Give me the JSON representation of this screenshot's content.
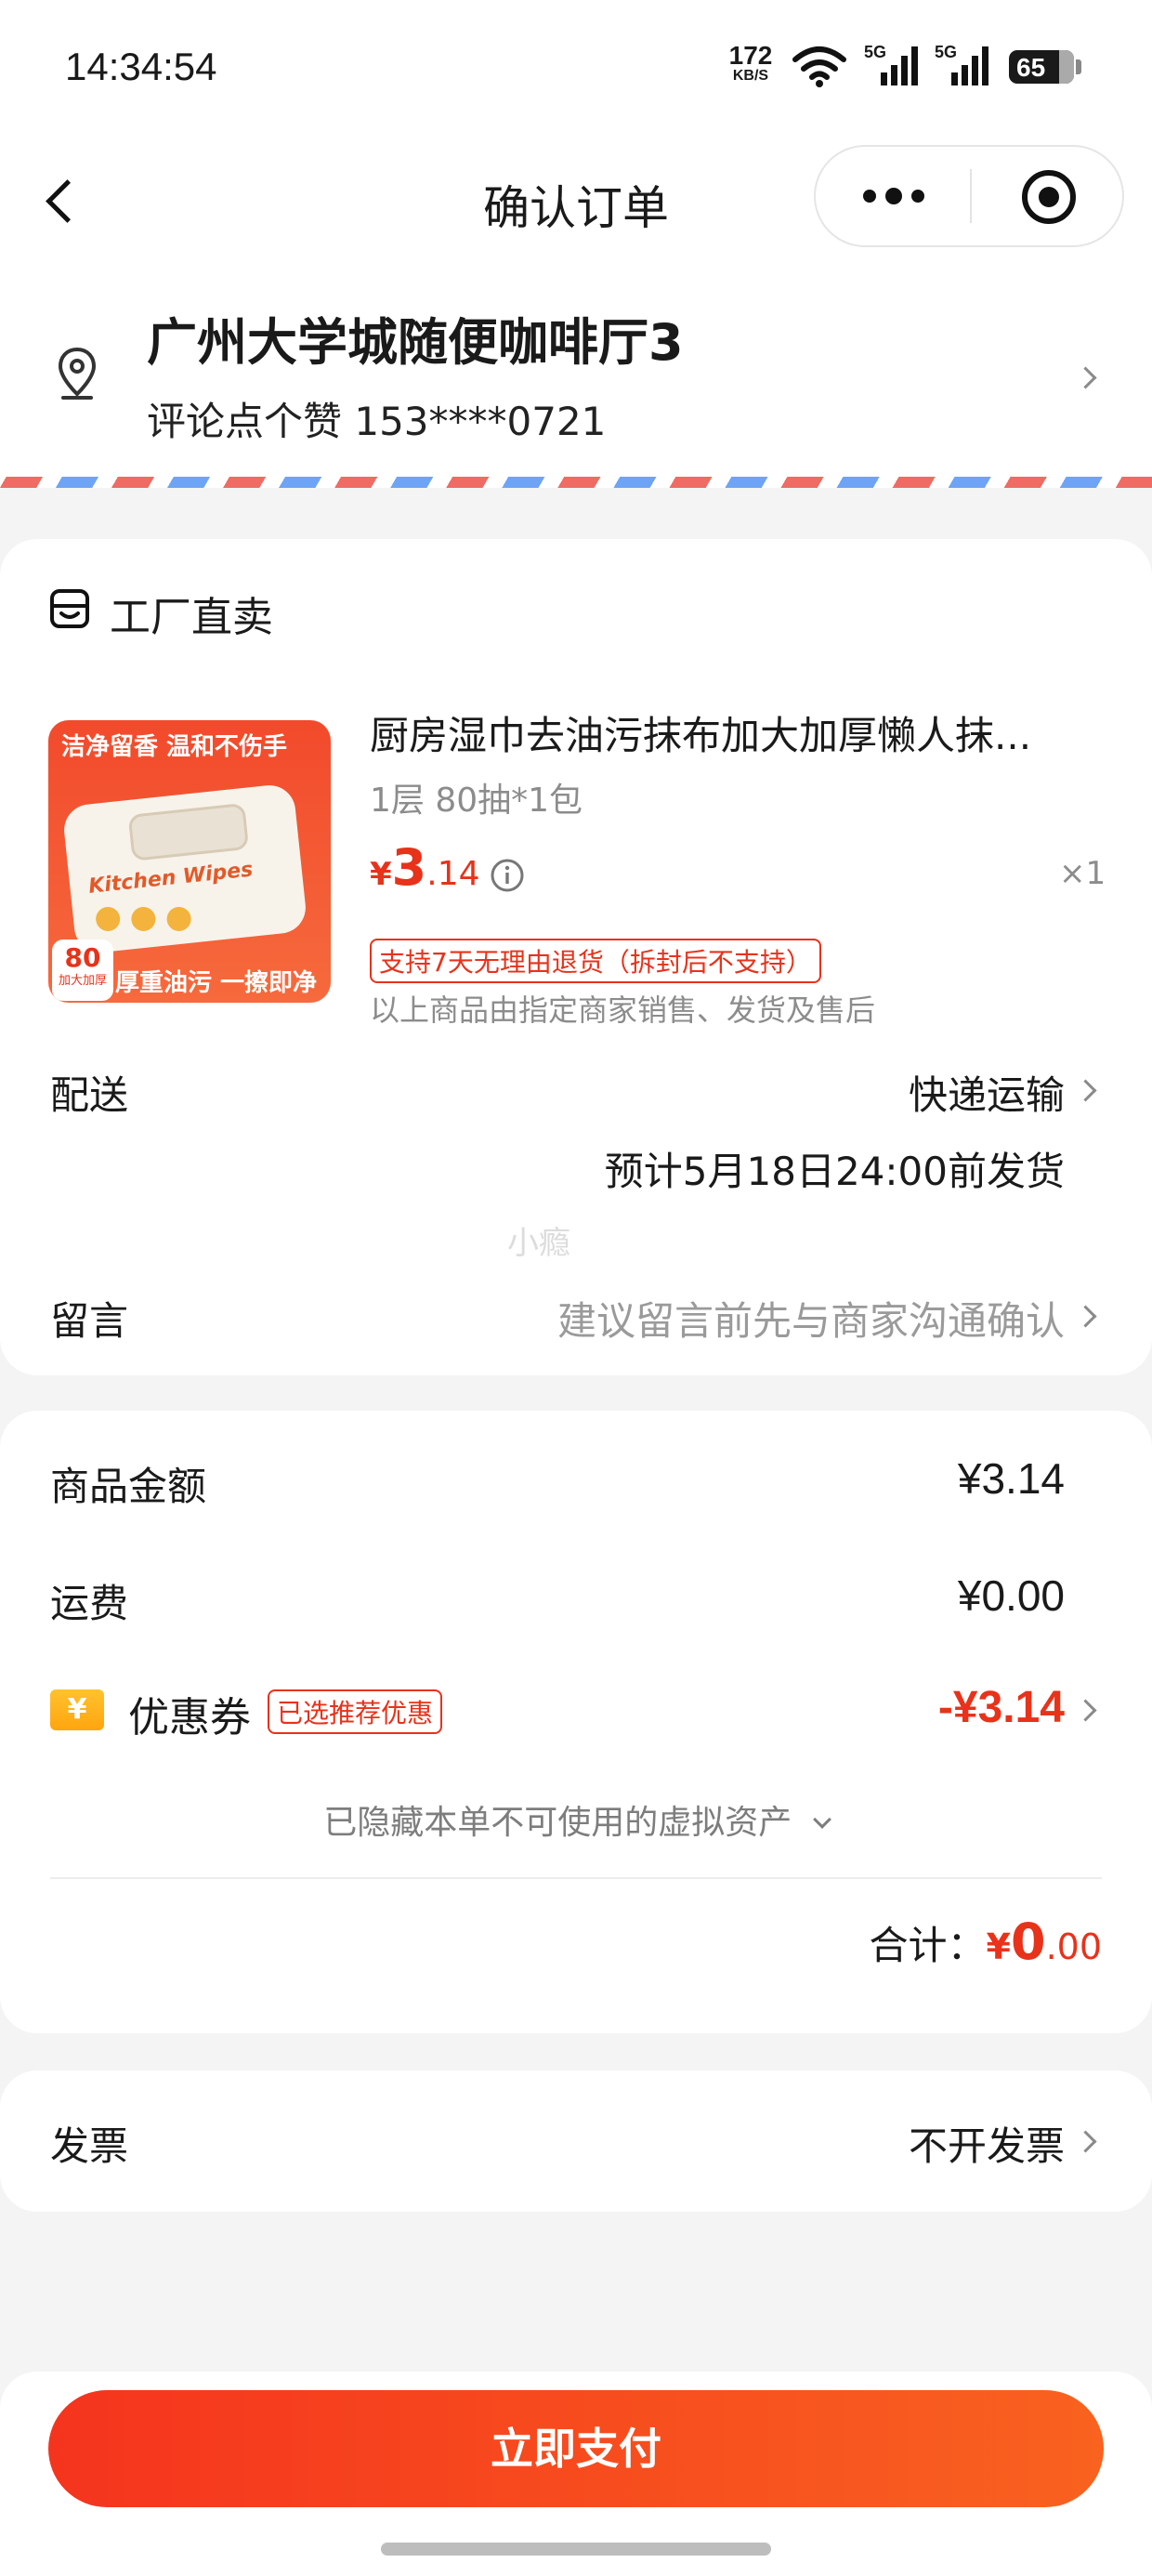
{
  "status_bar": {
    "time": "14:34:54",
    "net_speed": "172",
    "net_unit": "KB/S",
    "sig1": "5G",
    "sig2": "5G",
    "battery": "65"
  },
  "nav": {
    "title": "确认订单"
  },
  "address": {
    "name": "广州大学城随便咖啡厅3",
    "contact": "评论点个赞 153****0721"
  },
  "shop": {
    "name": "工厂直卖"
  },
  "product": {
    "title": "厨房湿巾去油污抹布加大加厚懒人抹...",
    "spec": "1层 80抽*1包",
    "price_symbol": "¥",
    "price_int": "3",
    "price_dec": ".14",
    "qty": "×1",
    "return_tag": "支持7天无理由退货（拆封后不支持）",
    "seller_note": "以上商品由指定商家销售、发货及售后",
    "image": {
      "top_text": "洁净留香 温和不伤手",
      "badge_num": "80",
      "badge_sub": "加大加厚",
      "bottom_text": "厚重油污 一擦即净",
      "pack_text": "Kitchen Wipes"
    }
  },
  "delivery": {
    "label": "配送",
    "method": "快递运输",
    "eta": "预计5月18日24:00前发货"
  },
  "watermark": "小瘾",
  "message": {
    "label": "留言",
    "placeholder": "建议留言前先与商家沟通确认"
  },
  "summary": {
    "goods_label": "商品金额",
    "goods_value": "¥3.14",
    "shipping_label": "运费",
    "shipping_value": "¥0.00",
    "coupon_label": "优惠券",
    "coupon_tag": "已选推荐优惠",
    "coupon_value": "-¥3.14",
    "hidden_assets": "已隐藏本单不可使用的虚拟资产",
    "total_label": "合计：",
    "total_symbol": "¥",
    "total_int": "0",
    "total_dec": ".00"
  },
  "invoice": {
    "label": "发票",
    "value": "不开发票"
  },
  "pay_button": "立即支付",
  "colors": {
    "accent": "#e8321a",
    "pay_start": "#f5341e",
    "pay_end": "#f9621f",
    "airmail_red": "#ef6b63",
    "airmail_blue": "#6ea4f5"
  }
}
